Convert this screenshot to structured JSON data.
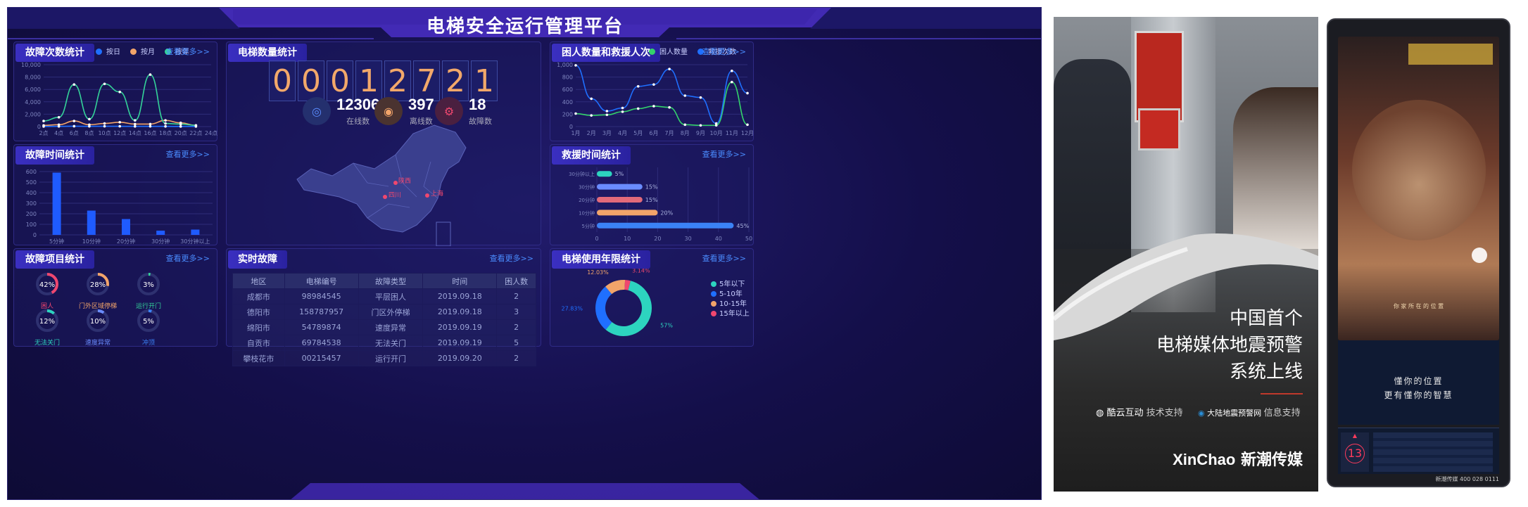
{
  "dashboard": {
    "title": "电梯安全运行管理平台",
    "more_label": "查看更多>>",
    "fault_count": {
      "title": "故障次数统计",
      "legend": [
        "按日",
        "按月",
        "按年"
      ],
      "legend_colors": [
        "#1f6fff",
        "#f2a46a",
        "#34d399"
      ],
      "y_ticks": [
        "10,000",
        "8,000",
        "6,000",
        "4,000",
        "2,000",
        "0"
      ],
      "x_ticks": [
        "2点",
        "4点",
        "6点",
        "8点",
        "10点",
        "12点",
        "14点",
        "16点",
        "18点",
        "20点",
        "22点",
        "24点"
      ],
      "series": [
        {
          "name": "按日",
          "values": [
            20,
            30,
            60,
            40,
            50,
            45,
            30,
            40,
            30,
            20,
            20
          ]
        },
        {
          "name": "按月",
          "values": [
            200,
            300,
            900,
            300,
            500,
            700,
            400,
            400,
            1000,
            600,
            200
          ]
        },
        {
          "name": "按年",
          "values": [
            900,
            1500,
            6800,
            1200,
            6900,
            5600,
            1000,
            8400,
            500,
            400,
            200
          ]
        }
      ]
    },
    "elevator_count": {
      "title": "电梯数量统计",
      "digits": [
        "0",
        "0",
        "0",
        "1",
        "2",
        "7",
        "2",
        "1"
      ],
      "online": {
        "value": "12306",
        "label": "在线数"
      },
      "offline": {
        "value": "397",
        "label": "离线数"
      },
      "fault": {
        "value": "18",
        "label": "故障数"
      },
      "map_labels": [
        "陕西",
        "四川",
        "上海"
      ]
    },
    "trapped": {
      "title": "困人数量和救援人次",
      "legend": [
        "困人数量",
        "救援次数"
      ],
      "legend_colors": [
        "#34d36b",
        "#1f6fff"
      ],
      "y_ticks": [
        "1,000",
        "800",
        "600",
        "400",
        "200",
        "0"
      ],
      "x_ticks": [
        "1月",
        "2月",
        "3月",
        "4月",
        "5月",
        "6月",
        "7月",
        "8月",
        "9月",
        "10月",
        "11月",
        "12月"
      ],
      "series": [
        {
          "name": "困人数量",
          "values": [
            210,
            180,
            190,
            240,
            290,
            330,
            310,
            30,
            20,
            20,
            720,
            30
          ]
        },
        {
          "name": "救援次数",
          "values": [
            990,
            450,
            250,
            300,
            650,
            680,
            930,
            500,
            470,
            50,
            900,
            540
          ]
        }
      ]
    },
    "fault_time": {
      "title": "故障时间统计",
      "y_ticks": [
        "600",
        "500",
        "400",
        "300",
        "200",
        "100",
        "0"
      ],
      "categories": [
        "5分钟",
        "10分钟",
        "20分钟",
        "30分钟",
        "30分钟以上"
      ],
      "values": [
        590,
        230,
        150,
        40,
        50
      ]
    },
    "rescue_time": {
      "title": "救援时间统计",
      "categories": [
        "30分钟以上",
        "30分钟",
        "20分钟",
        "10分钟",
        "5分钟"
      ],
      "values": [
        5,
        15,
        15,
        20,
        45
      ],
      "labels": [
        "5%",
        "15%",
        "15%",
        "20%",
        "45%"
      ],
      "colors": [
        "#2dd4bf",
        "#6a8cff",
        "#e26a7a",
        "#f2a46a",
        "#3b82f6"
      ],
      "x_ticks": [
        "0",
        "10",
        "20",
        "30",
        "40",
        "50"
      ]
    },
    "fault_items": {
      "title": "故障项目统计",
      "items": [
        {
          "pct": "42%",
          "label": "困人",
          "color": "#ef476f",
          "value": 42
        },
        {
          "pct": "28%",
          "label": "门外区域停梯",
          "color": "#f2a46a",
          "value": 28
        },
        {
          "pct": "3%",
          "label": "运行开门",
          "color": "#34d399",
          "value": 3
        },
        {
          "pct": "12%",
          "label": "无法关门",
          "color": "#2dd4bf",
          "value": 12
        },
        {
          "pct": "10%",
          "label": "速度异常",
          "color": "#6a8cff",
          "value": 10
        },
        {
          "pct": "5%",
          "label": "冲顶",
          "color": "#3b82f6",
          "value": 5
        }
      ]
    },
    "realtime": {
      "title": "实时故障",
      "headers": [
        "地区",
        "电梯编号",
        "故障类型",
        "时间",
        "困人数"
      ],
      "rows": [
        [
          "成都市",
          "98984545",
          "平层困人",
          "2019.09.18",
          "2"
        ],
        [
          "德阳市",
          "158787957",
          "门区外停梯",
          "2019.09.18",
          "3"
        ],
        [
          "绵阳市",
          "54789874",
          "速度异常",
          "2019.09.19",
          "2"
        ],
        [
          "自贡市",
          "69784538",
          "无法关门",
          "2019.09.19",
          "5"
        ],
        [
          "攀枝花市",
          "00215457",
          "运行开门",
          "2019.09.20",
          "2"
        ]
      ]
    },
    "years": {
      "title": "电梯使用年限统计",
      "legend": [
        "5年以下",
        "5-10年",
        "10-15年",
        "15年以上"
      ],
      "colors": [
        "#2dd4bf",
        "#1f6fff",
        "#f2a46a",
        "#ef476f"
      ],
      "values": [
        57,
        27.83,
        12.03,
        3.14
      ],
      "labels": [
        "57%",
        "27.83%",
        "12.03%",
        "3.14%"
      ]
    }
  },
  "ad": {
    "headline_lines": [
      "中国首个",
      "电梯媒体地震预警",
      "系统上线"
    ],
    "partner1": "酷云互动",
    "partner1_role": "技术支持",
    "partner2": "大陆地震预警网",
    "partner2_role": "信息支持",
    "brand_en": "XinChao",
    "brand_cn": "新潮传媒"
  },
  "phone": {
    "caption_lines": [
      "懂你的位置",
      "更有懂你的智慧"
    ],
    "number": "13",
    "small_caption": "你 家 所 在 的 位 置",
    "footer": "新潮传媒 400 028 0111"
  }
}
